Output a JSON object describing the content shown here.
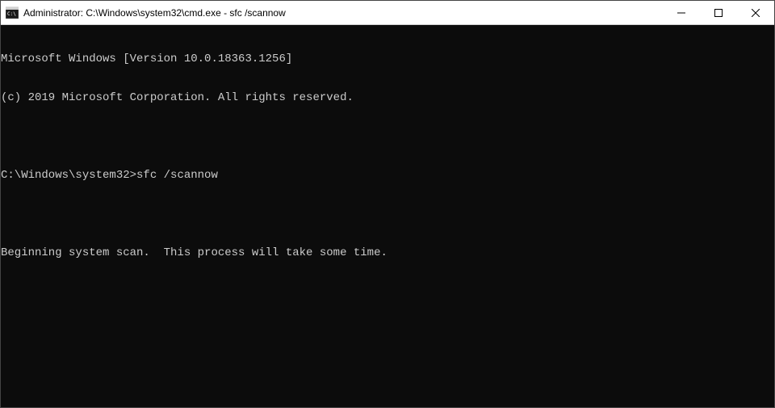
{
  "window": {
    "title": "Administrator: C:\\Windows\\system32\\cmd.exe - sfc  /scannow"
  },
  "terminal": {
    "line1": "Microsoft Windows [Version 10.0.18363.1256]",
    "line2": "(c) 2019 Microsoft Corporation. All rights reserved.",
    "blank1": "",
    "prompt": "C:\\Windows\\system32>",
    "command": "sfc /scannow",
    "blank2": "",
    "output1": "Beginning system scan.  This process will take some time."
  }
}
